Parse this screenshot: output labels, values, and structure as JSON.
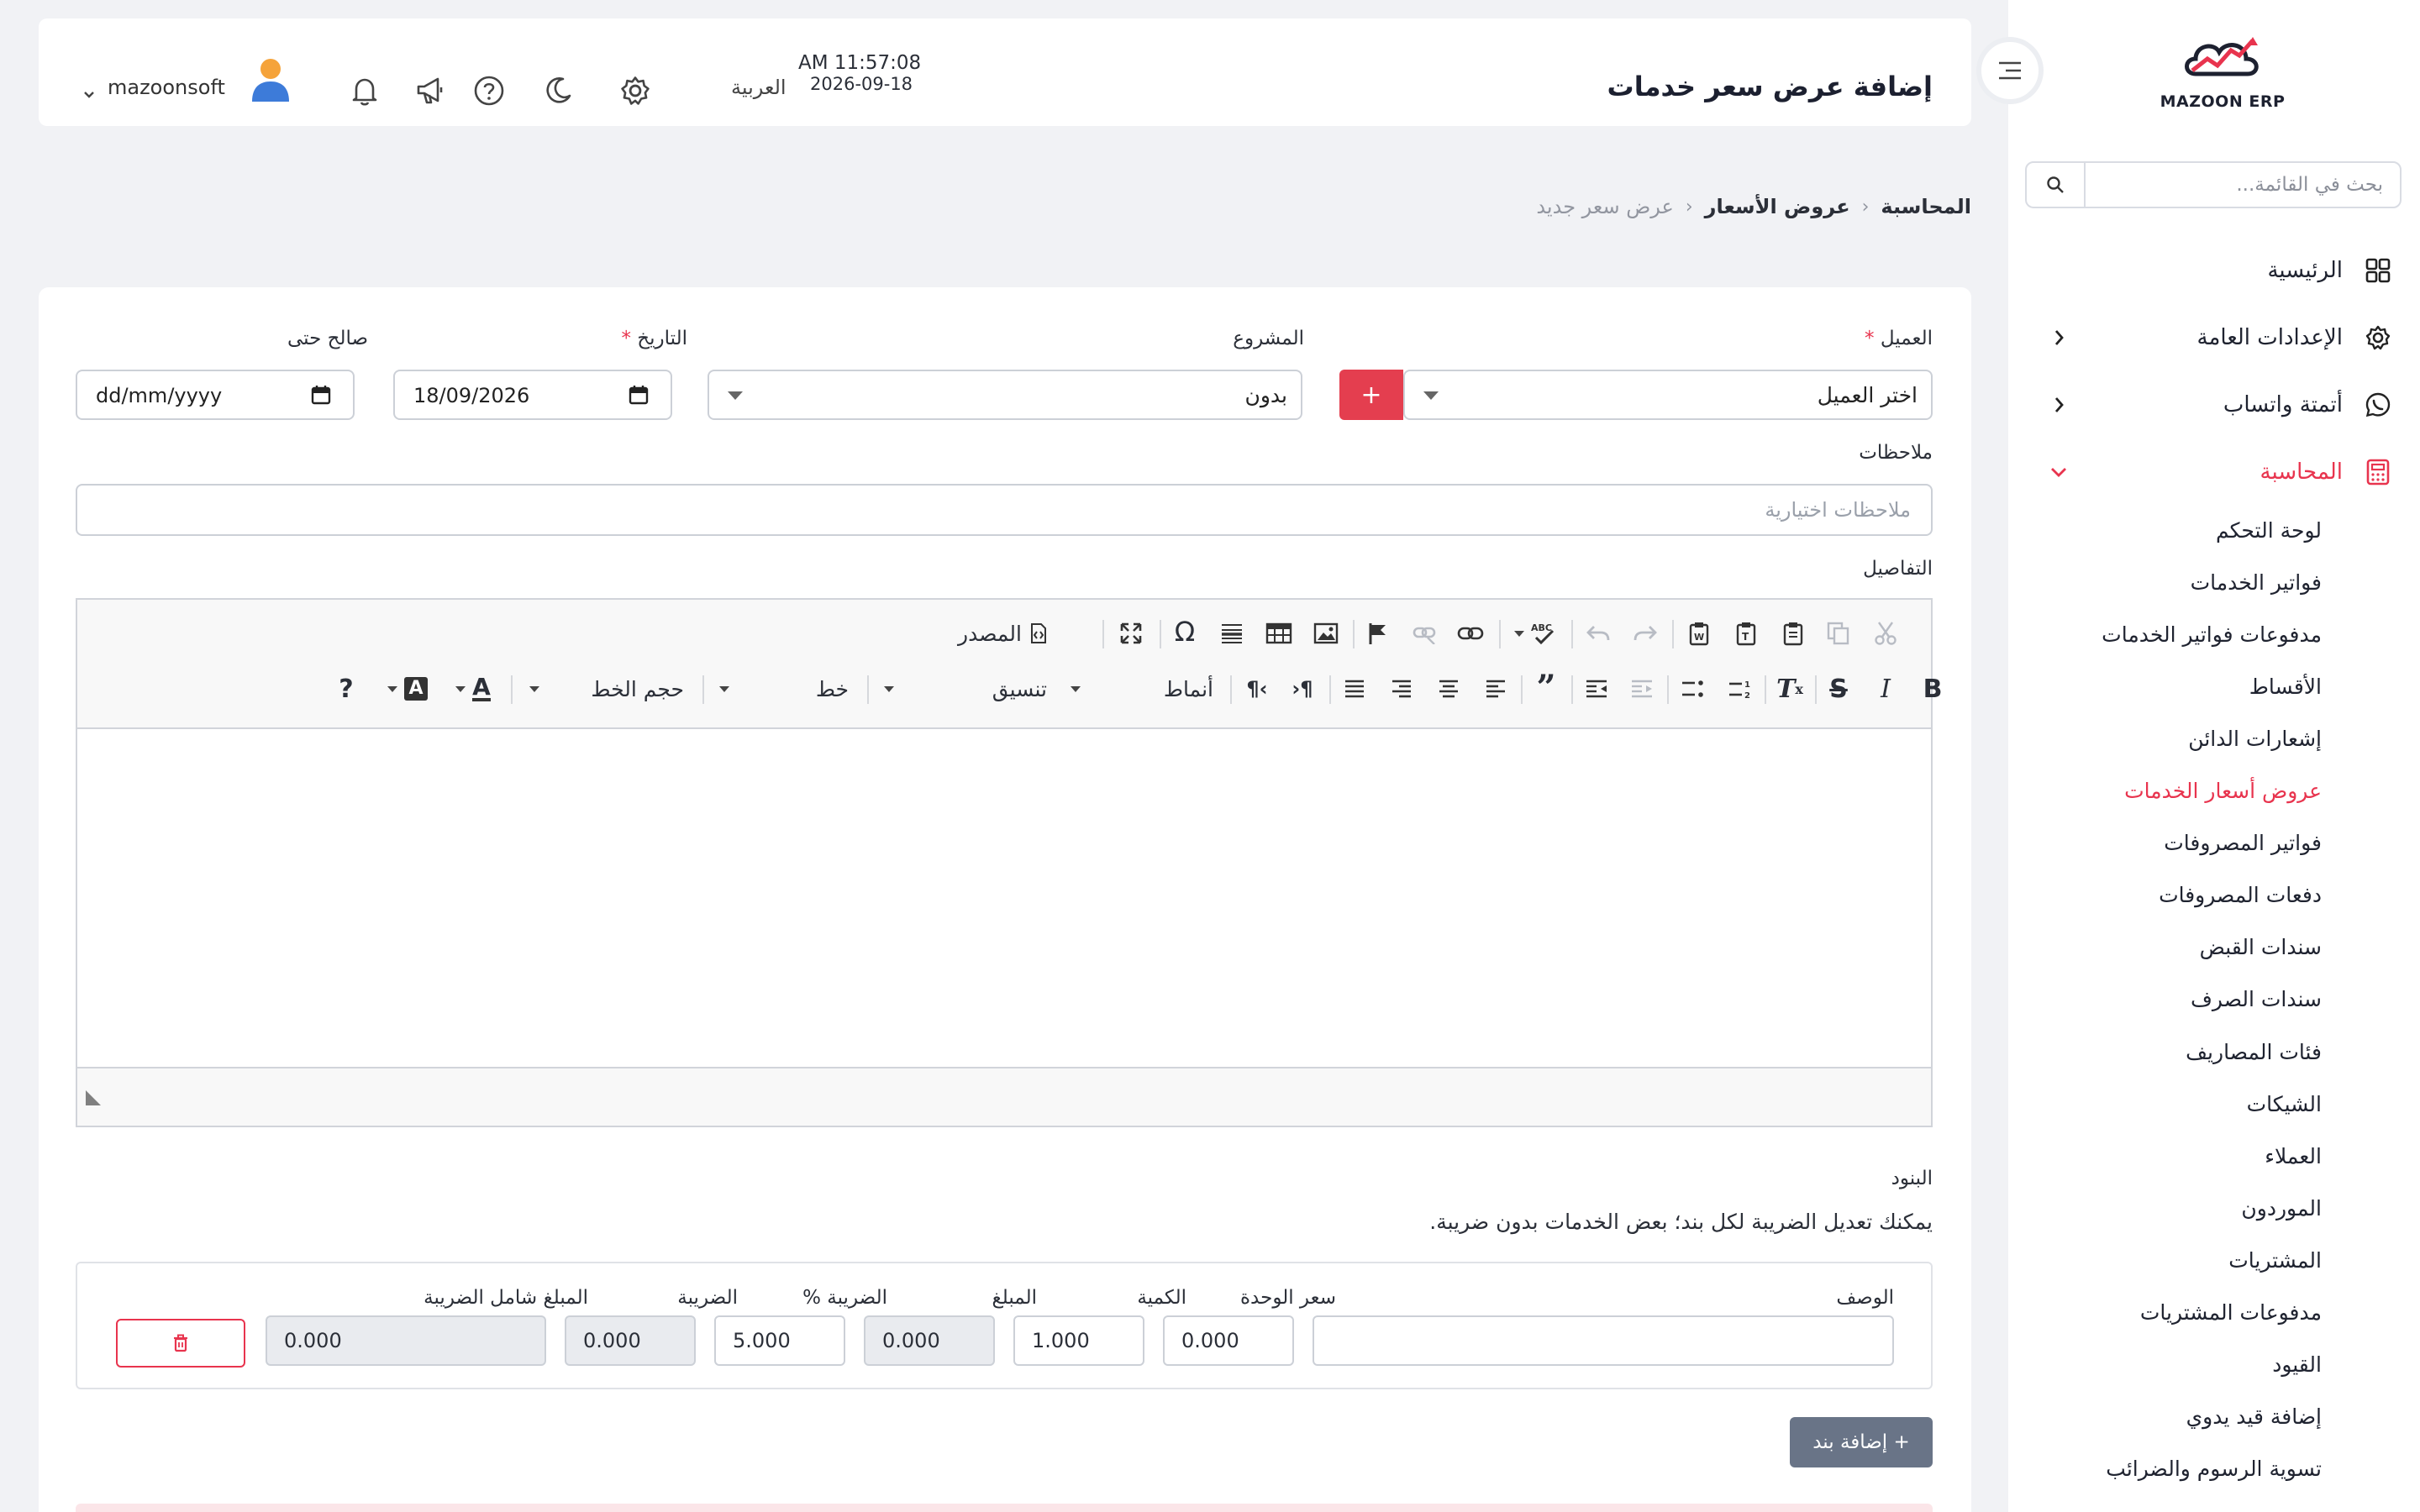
{
  "sidebar": {
    "logo_text": "MAZOON ERP",
    "search_placeholder": "بحث في القائمة...",
    "top_items": [
      {
        "label": "الرئيسية",
        "icon": "grid-icon"
      },
      {
        "label": "الإعدادات العامة",
        "icon": "gear-icon"
      },
      {
        "label": "أتمتة واتساب",
        "icon": "whatsapp-icon"
      },
      {
        "label": "المحاسبة",
        "icon": "calculator-icon"
      }
    ],
    "accounting_items": [
      {
        "label": "لوحة التحكم"
      },
      {
        "label": "فواتير الخدمات"
      },
      {
        "label": "مدفوعات فواتير الخدمات"
      },
      {
        "label": "الأقساط"
      },
      {
        "label": "إشعارات الدائن"
      },
      {
        "label": "عروض أسعار الخدمات"
      },
      {
        "label": "فواتير المصروفات"
      },
      {
        "label": "دفعات المصروفات"
      },
      {
        "label": "سندات القبض"
      },
      {
        "label": "سندات الصرف"
      },
      {
        "label": "فئات المصاريف"
      },
      {
        "label": "الشيكات"
      },
      {
        "label": "العملاء"
      },
      {
        "label": "الموردون"
      },
      {
        "label": "المشتريات"
      },
      {
        "label": "مدفوعات المشتريات"
      },
      {
        "label": "القيود"
      },
      {
        "label": "إضافة قيد يدوي"
      },
      {
        "label": "تسوية الرسوم والضرائب"
      }
    ],
    "active_color": "#e8344e"
  },
  "header": {
    "title": "إضافة عرض سعر خدمات",
    "time": "AM 11:57:08",
    "date": "2026-09-18",
    "language": "العربية",
    "username": "mazoonsoft"
  },
  "breadcrumb": [
    "المحاسبة",
    "عروض الأسعار",
    "عرض سعر جديد"
  ],
  "form": {
    "customer_label": "العميل",
    "customer_value": "اختر العميل",
    "add_customer_label": "+",
    "project_label": "المشروع",
    "project_value": "بدون",
    "date_label": "التاريخ",
    "date_value": "18/09/2026",
    "valid_until_label": "صالح حتى",
    "valid_until_value": "dd/mm/yyyy",
    "required_mark": "*",
    "notes_label": "ملاحظات",
    "notes_placeholder": "ملاحظات اختيارية",
    "details_label": "التفاصيل"
  },
  "editor": {
    "source_label": "المصدر",
    "styles_label": "أنماط",
    "format_label": "تنسيق",
    "font_label": "خط",
    "size_label": "حجم الخط",
    "help_label": "?"
  },
  "lines": {
    "title": "البنود",
    "hint": "يمكنك تعديل الضريبة لكل بند؛ بعض الخدمات بدون ضريبة.",
    "headers": {
      "description": "الوصف",
      "unit_price": "سعر الوحدة",
      "quantity": "الكمية",
      "amount": "المبلغ",
      "tax_percent": "الضريبة %",
      "tax": "الضريبة",
      "total": "المبلغ شامل الضريبة"
    },
    "row": {
      "description": "",
      "unit_price": "0.000",
      "quantity": "1.000",
      "amount": "0.000",
      "tax_percent": "5.000",
      "tax": "0.000",
      "total": "0.000"
    },
    "add_line_label": "+ إضافة بند"
  }
}
